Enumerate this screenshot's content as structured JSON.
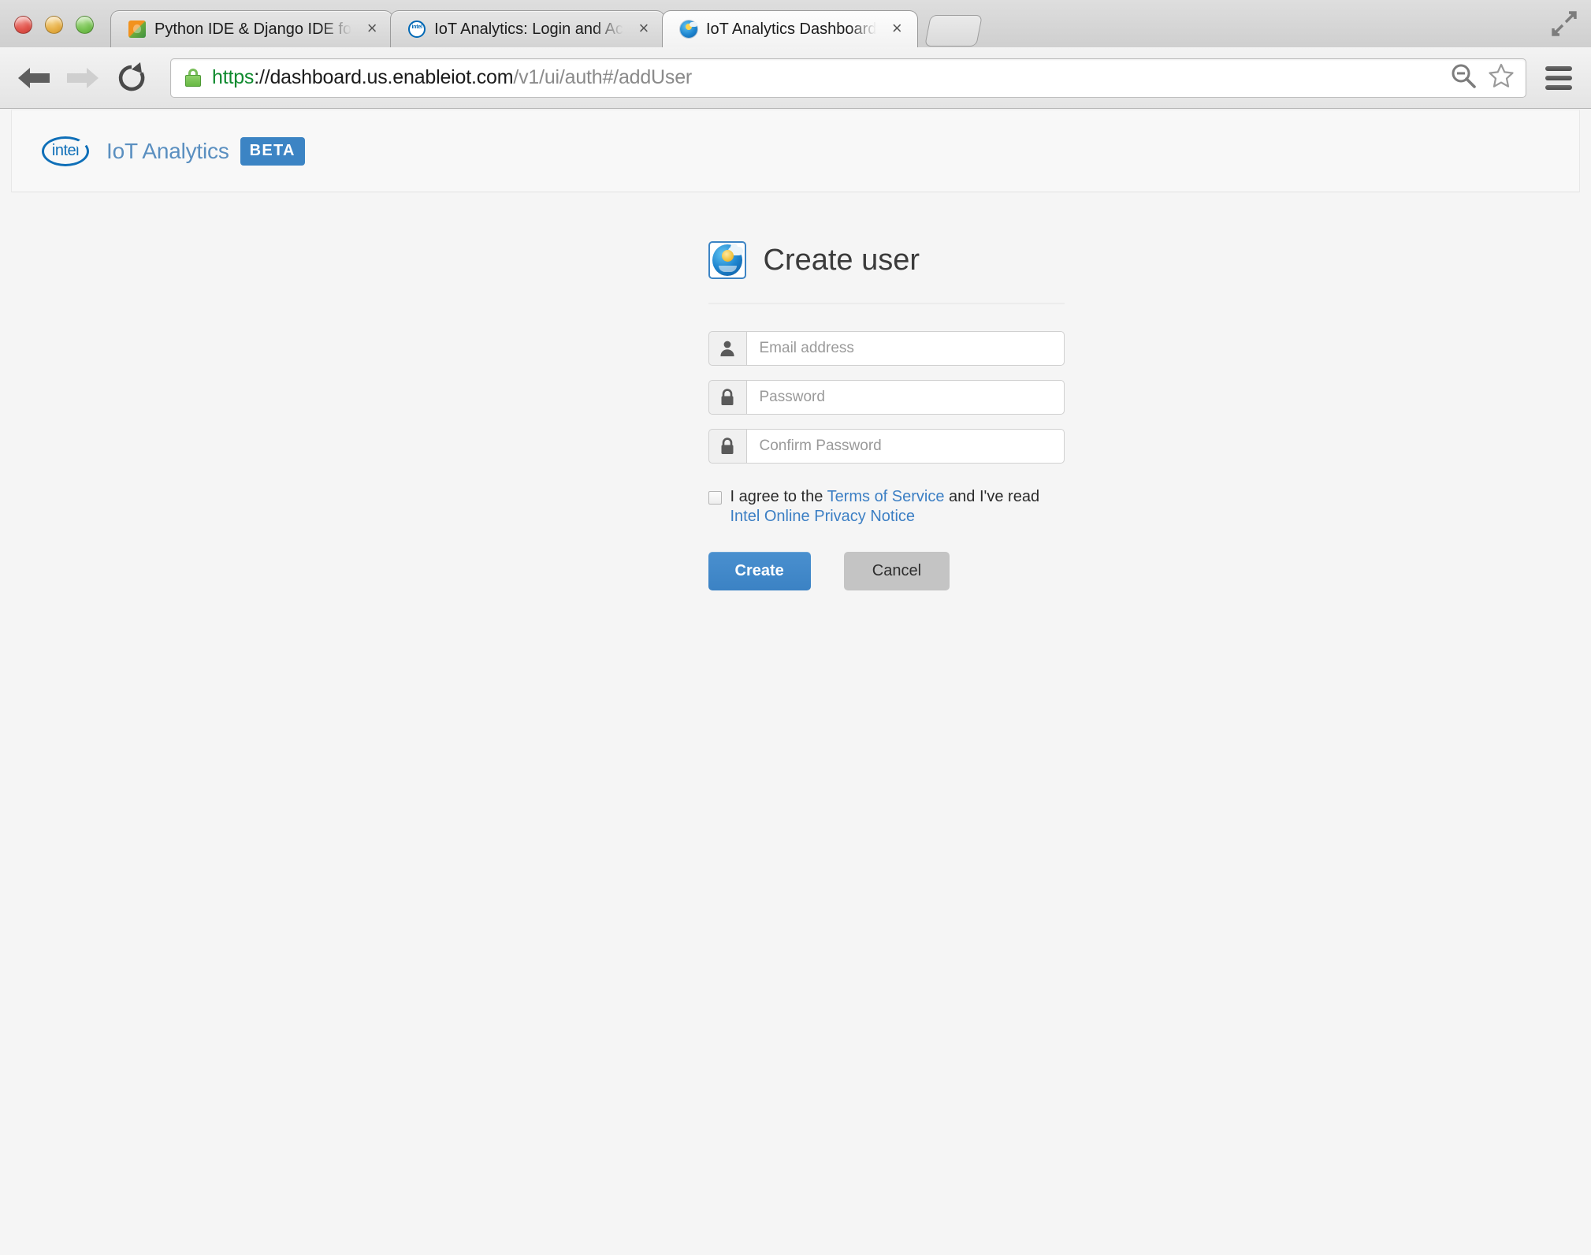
{
  "window": {
    "traffic_lights": [
      "close",
      "minimize",
      "zoom"
    ],
    "fullscreen_icon": "fullscreen-expand-icon"
  },
  "tabs": [
    {
      "title": "Python IDE & Django IDE fo",
      "favicon": "pycharm-icon",
      "active": false,
      "close_label": "×"
    },
    {
      "title": "IoT Analytics: Login and Ac",
      "favicon": "intel-icon",
      "active": false,
      "close_label": "×"
    },
    {
      "title": "IoT Analytics Dashboard",
      "favicon": "iot-cloud-icon",
      "active": true,
      "close_label": "×"
    }
  ],
  "toolbar": {
    "back_icon": "back-arrow-icon",
    "forward_icon": "forward-arrow-icon",
    "reload_icon": "reload-icon",
    "zoom_out_icon": "zoom-out-icon",
    "bookmark_icon": "star-icon",
    "menu_icon": "hamburger-menu-icon",
    "new_tab_label": ""
  },
  "address_bar": {
    "lock_icon": "https-lock-icon",
    "scheme": "https",
    "host": "://dashboard.us.enableiot.com",
    "path": "/v1/ui/auth#/addUser",
    "full_url": "https://dashboard.us.enableiot.com/v1/ui/auth#/addUser"
  },
  "app_header": {
    "logo_text": "intel",
    "brand": "IoT Analytics",
    "badge": "BETA"
  },
  "form": {
    "icon": "iot-cloud-icon",
    "title": "Create user",
    "fields": [
      {
        "name": "email",
        "icon": "user-icon",
        "placeholder": "Email address",
        "value": "",
        "type": "text"
      },
      {
        "name": "password",
        "icon": "lock-icon",
        "placeholder": "Password",
        "value": "",
        "type": "password"
      },
      {
        "name": "confirm",
        "icon": "lock-icon",
        "placeholder": "Confirm Password",
        "value": "",
        "type": "password"
      }
    ],
    "terms": {
      "checked": false,
      "prefix": "I agree to the ",
      "link1": "Terms of Service",
      "middle": " and I've read ",
      "link2": "Intel Online Privacy Notice"
    },
    "buttons": {
      "create": "Create",
      "cancel": "Cancel"
    }
  },
  "colors": {
    "accent": "#3c84c4",
    "link": "#3c7fc4",
    "brand_text": "#5a8fc0",
    "cancel_bg": "#c4c4c4",
    "page_bg": "#f5f5f5",
    "lock_green": "#0f8a2e"
  }
}
